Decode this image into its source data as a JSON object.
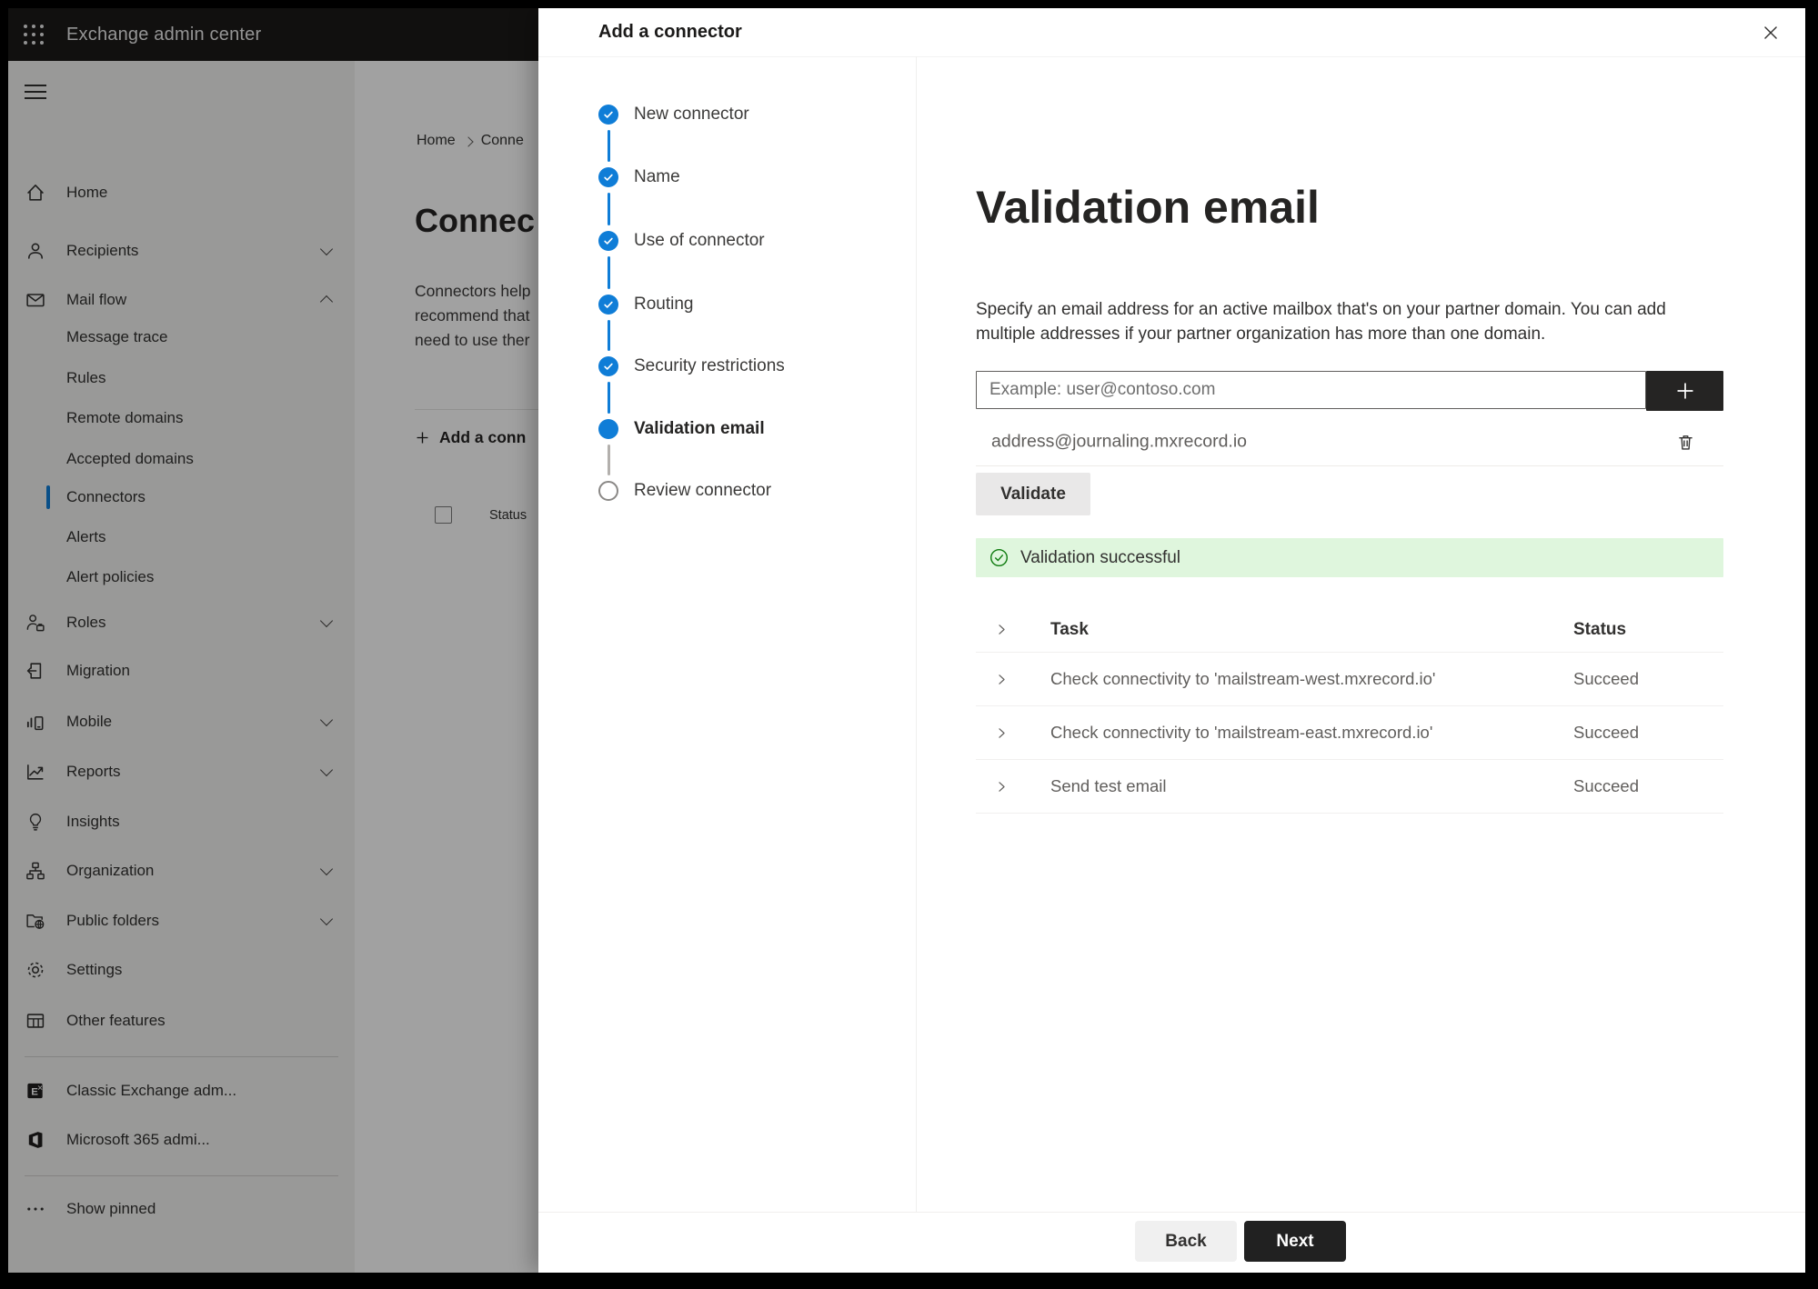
{
  "topbar": {
    "title": "Exchange admin center"
  },
  "sidebar": {
    "items": [
      {
        "label": "Home",
        "icon": "home-icon",
        "type": "main"
      },
      {
        "label": "Recipients",
        "icon": "person-icon",
        "type": "main",
        "chevron": "down"
      },
      {
        "label": "Mail flow",
        "icon": "mail-icon",
        "type": "main",
        "chevron": "up"
      },
      {
        "label": "Message trace",
        "type": "sub"
      },
      {
        "label": "Rules",
        "type": "sub"
      },
      {
        "label": "Remote domains",
        "type": "sub"
      },
      {
        "label": "Accepted domains",
        "type": "sub"
      },
      {
        "label": "Connectors",
        "type": "sub",
        "selected": true
      },
      {
        "label": "Alerts",
        "type": "sub"
      },
      {
        "label": "Alert policies",
        "type": "sub"
      },
      {
        "label": "Roles",
        "icon": "roles-icon",
        "type": "main",
        "chevron": "down"
      },
      {
        "label": "Migration",
        "icon": "migration-icon",
        "type": "main"
      },
      {
        "label": "Mobile",
        "icon": "mobile-icon",
        "type": "main",
        "chevron": "down"
      },
      {
        "label": "Reports",
        "icon": "reports-icon",
        "type": "main",
        "chevron": "down"
      },
      {
        "label": "Insights",
        "icon": "insights-icon",
        "type": "main"
      },
      {
        "label": "Organization",
        "icon": "organization-icon",
        "type": "main",
        "chevron": "down"
      },
      {
        "label": "Public folders",
        "icon": "public-folders-icon",
        "type": "main",
        "chevron": "down"
      },
      {
        "label": "Settings",
        "icon": "settings-icon",
        "type": "main"
      },
      {
        "label": "Other features",
        "icon": "other-features-icon",
        "type": "main"
      },
      {
        "type": "divider"
      },
      {
        "label": "Classic Exchange adm...",
        "icon": "classic-exchange-icon",
        "type": "main"
      },
      {
        "label": "Microsoft 365 admi...",
        "icon": "microsoft-365-icon",
        "type": "main"
      },
      {
        "type": "divider"
      },
      {
        "label": "Show pinned",
        "icon": "ellipsis-icon",
        "type": "main"
      }
    ]
  },
  "background_page": {
    "breadcrumb": [
      "Home",
      "Conne"
    ],
    "title": "Connec",
    "description_lines": [
      "Connectors help",
      "recommend that",
      "need to use ther"
    ],
    "add_button_label": "Add a conn",
    "column_header": "Status"
  },
  "wizard": {
    "title": "Add a connector",
    "steps": [
      {
        "label": "New connector",
        "state": "completed"
      },
      {
        "label": "Name",
        "state": "completed"
      },
      {
        "label": "Use of connector",
        "state": "completed"
      },
      {
        "label": "Routing",
        "state": "completed"
      },
      {
        "label": "Security restrictions",
        "state": "completed"
      },
      {
        "label": "Validation email",
        "state": "current"
      },
      {
        "label": "Review connector",
        "state": "upcoming"
      }
    ]
  },
  "main": {
    "title": "Validation email",
    "description": "Specify an email address for an active mailbox that's on your partner domain. You can add multiple addresses if your partner organization has more than one domain.",
    "email_input": {
      "value": "",
      "placeholder": "Example: user@contoso.com"
    },
    "added_address": "address@journaling.mxrecord.io",
    "validate_label": "Validate",
    "banner": {
      "status": "success",
      "text": "Validation successful"
    },
    "results_table": {
      "columns": [
        "Task",
        "Status"
      ],
      "rows": [
        {
          "task": "Check connectivity to 'mailstream-west.mxrecord.io'",
          "status": "Succeed"
        },
        {
          "task": "Check connectivity to 'mailstream-east.mxrecord.io'",
          "status": "Succeed"
        },
        {
          "task": "Send test email",
          "status": "Succeed"
        }
      ]
    },
    "footer": {
      "back_label": "Back",
      "next_label": "Next"
    }
  },
  "colors": {
    "accent_blue": "#0f7dd7",
    "success_green": "#107c10",
    "success_background": "#dff6dd",
    "topbar_background": "#1b1a19"
  }
}
